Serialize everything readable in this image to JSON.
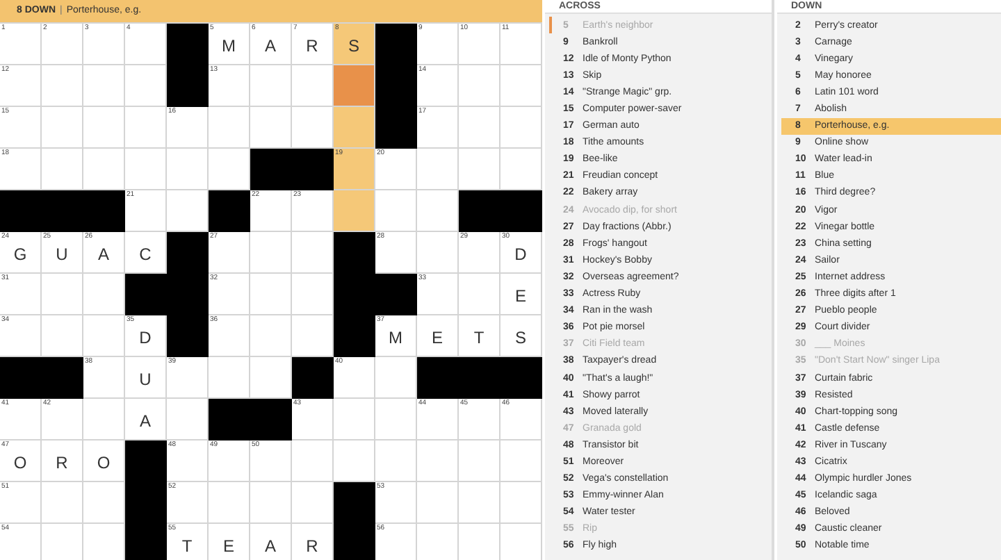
{
  "clue_bar": {
    "label": "8 DOWN",
    "separator": "|",
    "text": "Porterhouse, e.g."
  },
  "grid": {
    "rows": [
      [
        {
          "kind": "open",
          "number": "1"
        },
        {
          "kind": "open",
          "number": "2"
        },
        {
          "kind": "open",
          "number": "3"
        },
        {
          "kind": "open",
          "number": "4"
        },
        {
          "kind": "block"
        },
        {
          "kind": "open",
          "number": "5",
          "letter": "M"
        },
        {
          "kind": "open",
          "number": "6",
          "letter": "A"
        },
        {
          "kind": "open",
          "number": "7",
          "letter": "R"
        },
        {
          "kind": "word",
          "number": "8",
          "letter": "S"
        },
        {
          "kind": "block"
        },
        {
          "kind": "open",
          "number": "9"
        },
        {
          "kind": "open",
          "number": "10"
        },
        {
          "kind": "open",
          "number": "11"
        }
      ],
      [
        {
          "kind": "open",
          "number": "12"
        },
        {
          "kind": "open"
        },
        {
          "kind": "open"
        },
        {
          "kind": "open"
        },
        {
          "kind": "block"
        },
        {
          "kind": "open",
          "number": "13"
        },
        {
          "kind": "open"
        },
        {
          "kind": "open"
        },
        {
          "kind": "cursor"
        },
        {
          "kind": "block"
        },
        {
          "kind": "open",
          "number": "14"
        },
        {
          "kind": "open"
        },
        {
          "kind": "open"
        }
      ],
      [
        {
          "kind": "open",
          "number": "15"
        },
        {
          "kind": "open"
        },
        {
          "kind": "open"
        },
        {
          "kind": "open"
        },
        {
          "kind": "open",
          "number": "16"
        },
        {
          "kind": "open"
        },
        {
          "kind": "open"
        },
        {
          "kind": "open"
        },
        {
          "kind": "word"
        },
        {
          "kind": "block"
        },
        {
          "kind": "open",
          "number": "17"
        },
        {
          "kind": "open"
        },
        {
          "kind": "open"
        }
      ],
      [
        {
          "kind": "open",
          "number": "18"
        },
        {
          "kind": "open"
        },
        {
          "kind": "open"
        },
        {
          "kind": "open"
        },
        {
          "kind": "open"
        },
        {
          "kind": "open"
        },
        {
          "kind": "block"
        },
        {
          "kind": "block"
        },
        {
          "kind": "word",
          "number": "19"
        },
        {
          "kind": "open",
          "number": "20"
        },
        {
          "kind": "open"
        },
        {
          "kind": "open"
        },
        {
          "kind": "open"
        }
      ],
      [
        {
          "kind": "block"
        },
        {
          "kind": "block"
        },
        {
          "kind": "block"
        },
        {
          "kind": "open",
          "number": "21"
        },
        {
          "kind": "open"
        },
        {
          "kind": "block"
        },
        {
          "kind": "open",
          "number": "22"
        },
        {
          "kind": "open",
          "number": "23"
        },
        {
          "kind": "word"
        },
        {
          "kind": "open"
        },
        {
          "kind": "open"
        },
        {
          "kind": "block"
        },
        {
          "kind": "block"
        }
      ],
      [
        {
          "kind": "open",
          "number": "24",
          "letter": "G"
        },
        {
          "kind": "open",
          "number": "25",
          "letter": "U"
        },
        {
          "kind": "open",
          "number": "26",
          "letter": "A"
        },
        {
          "kind": "open",
          "letter": "C"
        },
        {
          "kind": "block"
        },
        {
          "kind": "open",
          "number": "27"
        },
        {
          "kind": "open"
        },
        {
          "kind": "open"
        },
        {
          "kind": "block"
        },
        {
          "kind": "open",
          "number": "28"
        },
        {
          "kind": "open"
        },
        {
          "kind": "open",
          "number": "29"
        },
        {
          "kind": "open",
          "number": "30",
          "letter": "D"
        }
      ],
      [
        {
          "kind": "open",
          "number": "31"
        },
        {
          "kind": "open"
        },
        {
          "kind": "open"
        },
        {
          "kind": "block"
        },
        {
          "kind": "block"
        },
        {
          "kind": "open",
          "number": "32"
        },
        {
          "kind": "open"
        },
        {
          "kind": "open"
        },
        {
          "kind": "block"
        },
        {
          "kind": "block"
        },
        {
          "kind": "open",
          "number": "33"
        },
        {
          "kind": "open"
        },
        {
          "kind": "open",
          "letter": "E"
        }
      ],
      [
        {
          "kind": "open",
          "number": "34"
        },
        {
          "kind": "open"
        },
        {
          "kind": "open"
        },
        {
          "kind": "open",
          "number": "35",
          "letter": "D"
        },
        {
          "kind": "block"
        },
        {
          "kind": "open",
          "number": "36"
        },
        {
          "kind": "open"
        },
        {
          "kind": "open"
        },
        {
          "kind": "block"
        },
        {
          "kind": "open",
          "number": "37",
          "letter": "M"
        },
        {
          "kind": "open",
          "letter": "E"
        },
        {
          "kind": "open",
          "letter": "T"
        },
        {
          "kind": "open",
          "letter": "S"
        }
      ],
      [
        {
          "kind": "block"
        },
        {
          "kind": "block"
        },
        {
          "kind": "open",
          "number": "38"
        },
        {
          "kind": "open",
          "letter": "U"
        },
        {
          "kind": "open",
          "number": "39"
        },
        {
          "kind": "open"
        },
        {
          "kind": "open"
        },
        {
          "kind": "block"
        },
        {
          "kind": "open",
          "number": "40"
        },
        {
          "kind": "open"
        },
        {
          "kind": "block"
        },
        {
          "kind": "block"
        },
        {
          "kind": "block"
        }
      ],
      [
        {
          "kind": "open",
          "number": "41"
        },
        {
          "kind": "open",
          "number": "42"
        },
        {
          "kind": "open"
        },
        {
          "kind": "open",
          "letter": "A"
        },
        {
          "kind": "open"
        },
        {
          "kind": "block"
        },
        {
          "kind": "block"
        },
        {
          "kind": "open",
          "number": "43"
        },
        {
          "kind": "open"
        },
        {
          "kind": "open"
        },
        {
          "kind": "open",
          "number": "44"
        },
        {
          "kind": "open",
          "number": "45"
        },
        {
          "kind": "open",
          "number": "46"
        }
      ],
      [
        {
          "kind": "open",
          "number": "47",
          "letter": "O"
        },
        {
          "kind": "open",
          "letter": "R"
        },
        {
          "kind": "open",
          "letter": "O"
        },
        {
          "kind": "block"
        },
        {
          "kind": "open",
          "number": "48"
        },
        {
          "kind": "open",
          "number": "49"
        },
        {
          "kind": "open",
          "number": "50"
        },
        {
          "kind": "open"
        },
        {
          "kind": "open"
        },
        {
          "kind": "open"
        },
        {
          "kind": "open"
        },
        {
          "kind": "open"
        },
        {
          "kind": "open"
        }
      ],
      [
        {
          "kind": "open",
          "number": "51"
        },
        {
          "kind": "open"
        },
        {
          "kind": "open"
        },
        {
          "kind": "block"
        },
        {
          "kind": "open",
          "number": "52"
        },
        {
          "kind": "open"
        },
        {
          "kind": "open"
        },
        {
          "kind": "open"
        },
        {
          "kind": "block"
        },
        {
          "kind": "open",
          "number": "53"
        },
        {
          "kind": "open"
        },
        {
          "kind": "open"
        },
        {
          "kind": "open"
        }
      ],
      [
        {
          "kind": "open",
          "number": "54"
        },
        {
          "kind": "open"
        },
        {
          "kind": "open"
        },
        {
          "kind": "block"
        },
        {
          "kind": "open",
          "number": "55",
          "letter": "T"
        },
        {
          "kind": "open",
          "letter": "E"
        },
        {
          "kind": "open",
          "letter": "A"
        },
        {
          "kind": "open",
          "letter": "R"
        },
        {
          "kind": "block"
        },
        {
          "kind": "open",
          "number": "56"
        },
        {
          "kind": "open"
        },
        {
          "kind": "open"
        },
        {
          "kind": "open"
        }
      ]
    ]
  },
  "clue_lists": [
    {
      "title": "ACROSS",
      "clues": [
        {
          "number": "5",
          "text": "Earth's neighbor",
          "completed": true,
          "crossing": true,
          "selected": false
        },
        {
          "number": "9",
          "text": "Bankroll",
          "completed": false,
          "crossing": false,
          "selected": false
        },
        {
          "number": "12",
          "text": "Idle of Monty Python",
          "completed": false,
          "crossing": false,
          "selected": false
        },
        {
          "number": "13",
          "text": "Skip",
          "completed": false,
          "crossing": false,
          "selected": false
        },
        {
          "number": "14",
          "text": "\"Strange Magic\" grp.",
          "completed": false,
          "crossing": false,
          "selected": false
        },
        {
          "number": "15",
          "text": "Computer power-saver",
          "completed": false,
          "crossing": false,
          "selected": false
        },
        {
          "number": "17",
          "text": "German auto",
          "completed": false,
          "crossing": false,
          "selected": false
        },
        {
          "number": "18",
          "text": "Tithe amounts",
          "completed": false,
          "crossing": false,
          "selected": false
        },
        {
          "number": "19",
          "text": "Bee-like",
          "completed": false,
          "crossing": false,
          "selected": false
        },
        {
          "number": "21",
          "text": "Freudian concept",
          "completed": false,
          "crossing": false,
          "selected": false
        },
        {
          "number": "22",
          "text": "Bakery array",
          "completed": false,
          "crossing": false,
          "selected": false
        },
        {
          "number": "24",
          "text": "Avocado dip, for short",
          "completed": true,
          "crossing": false,
          "selected": false
        },
        {
          "number": "27",
          "text": "Day fractions (Abbr.)",
          "completed": false,
          "crossing": false,
          "selected": false
        },
        {
          "number": "28",
          "text": "Frogs' hangout",
          "completed": false,
          "crossing": false,
          "selected": false
        },
        {
          "number": "31",
          "text": "Hockey's Bobby",
          "completed": false,
          "crossing": false,
          "selected": false
        },
        {
          "number": "32",
          "text": "Overseas agreement?",
          "completed": false,
          "crossing": false,
          "selected": false
        },
        {
          "number": "33",
          "text": "Actress Ruby",
          "completed": false,
          "crossing": false,
          "selected": false
        },
        {
          "number": "34",
          "text": "Ran in the wash",
          "completed": false,
          "crossing": false,
          "selected": false
        },
        {
          "number": "36",
          "text": "Pot pie morsel",
          "completed": false,
          "crossing": false,
          "selected": false
        },
        {
          "number": "37",
          "text": "Citi Field team",
          "completed": true,
          "crossing": false,
          "selected": false
        },
        {
          "number": "38",
          "text": "Taxpayer's dread",
          "completed": false,
          "crossing": false,
          "selected": false
        },
        {
          "number": "40",
          "text": "\"That's a laugh!\"",
          "completed": false,
          "crossing": false,
          "selected": false
        },
        {
          "number": "41",
          "text": "Showy parrot",
          "completed": false,
          "crossing": false,
          "selected": false
        },
        {
          "number": "43",
          "text": "Moved laterally",
          "completed": false,
          "crossing": false,
          "selected": false
        },
        {
          "number": "47",
          "text": "Granada gold",
          "completed": true,
          "crossing": false,
          "selected": false
        },
        {
          "number": "48",
          "text": "Transistor bit",
          "completed": false,
          "crossing": false,
          "selected": false
        },
        {
          "number": "51",
          "text": "Moreover",
          "completed": false,
          "crossing": false,
          "selected": false
        },
        {
          "number": "52",
          "text": "Vega's constellation",
          "completed": false,
          "crossing": false,
          "selected": false
        },
        {
          "number": "53",
          "text": "Emmy-winner Alan",
          "completed": false,
          "crossing": false,
          "selected": false
        },
        {
          "number": "54",
          "text": "Water tester",
          "completed": false,
          "crossing": false,
          "selected": false
        },
        {
          "number": "55",
          "text": "Rip",
          "completed": true,
          "crossing": false,
          "selected": false
        },
        {
          "number": "56",
          "text": "Fly high",
          "completed": false,
          "crossing": false,
          "selected": false
        }
      ]
    },
    {
      "title": "DOWN",
      "clues": [
        {
          "number": "2",
          "text": "Perry's creator",
          "completed": false,
          "crossing": false,
          "selected": false
        },
        {
          "number": "3",
          "text": "Carnage",
          "completed": false,
          "crossing": false,
          "selected": false
        },
        {
          "number": "4",
          "text": "Vinegary",
          "completed": false,
          "crossing": false,
          "selected": false
        },
        {
          "number": "5",
          "text": "May honoree",
          "completed": false,
          "crossing": false,
          "selected": false
        },
        {
          "number": "6",
          "text": "Latin 101 word",
          "completed": false,
          "crossing": false,
          "selected": false
        },
        {
          "number": "7",
          "text": "Abolish",
          "completed": false,
          "crossing": false,
          "selected": false
        },
        {
          "number": "8",
          "text": "Porterhouse, e.g.",
          "completed": false,
          "crossing": false,
          "selected": true
        },
        {
          "number": "9",
          "text": "Online show",
          "completed": false,
          "crossing": false,
          "selected": false
        },
        {
          "number": "10",
          "text": "Water lead-in",
          "completed": false,
          "crossing": false,
          "selected": false
        },
        {
          "number": "11",
          "text": "Blue",
          "completed": false,
          "crossing": false,
          "selected": false
        },
        {
          "number": "16",
          "text": "Third degree?",
          "completed": false,
          "crossing": false,
          "selected": false
        },
        {
          "number": "20",
          "text": "Vigor",
          "completed": false,
          "crossing": false,
          "selected": false
        },
        {
          "number": "22",
          "text": "Vinegar bottle",
          "completed": false,
          "crossing": false,
          "selected": false
        },
        {
          "number": "23",
          "text": "China setting",
          "completed": false,
          "crossing": false,
          "selected": false
        },
        {
          "number": "24",
          "text": "Sailor",
          "completed": false,
          "crossing": false,
          "selected": false
        },
        {
          "number": "25",
          "text": "Internet address",
          "completed": false,
          "crossing": false,
          "selected": false
        },
        {
          "number": "26",
          "text": "Three digits after 1",
          "completed": false,
          "crossing": false,
          "selected": false
        },
        {
          "number": "27",
          "text": "Pueblo people",
          "completed": false,
          "crossing": false,
          "selected": false
        },
        {
          "number": "29",
          "text": "Court divider",
          "completed": false,
          "crossing": false,
          "selected": false
        },
        {
          "number": "30",
          "text": "___ Moines",
          "completed": true,
          "crossing": false,
          "selected": false
        },
        {
          "number": "35",
          "text": "\"Don't Start Now\" singer Lipa",
          "completed": true,
          "crossing": false,
          "selected": false
        },
        {
          "number": "37",
          "text": "Curtain fabric",
          "completed": false,
          "crossing": false,
          "selected": false
        },
        {
          "number": "39",
          "text": "Resisted",
          "completed": false,
          "crossing": false,
          "selected": false
        },
        {
          "number": "40",
          "text": "Chart-topping song",
          "completed": false,
          "crossing": false,
          "selected": false
        },
        {
          "number": "41",
          "text": "Castle defense",
          "completed": false,
          "crossing": false,
          "selected": false
        },
        {
          "number": "42",
          "text": "River in Tuscany",
          "completed": false,
          "crossing": false,
          "selected": false
        },
        {
          "number": "43",
          "text": "Cicatrix",
          "completed": false,
          "crossing": false,
          "selected": false
        },
        {
          "number": "44",
          "text": "Olympic hurdler Jones",
          "completed": false,
          "crossing": false,
          "selected": false
        },
        {
          "number": "45",
          "text": "Icelandic saga",
          "completed": false,
          "crossing": false,
          "selected": false
        },
        {
          "number": "46",
          "text": "Beloved",
          "completed": false,
          "crossing": false,
          "selected": false
        },
        {
          "number": "49",
          "text": "Caustic cleaner",
          "completed": false,
          "crossing": false,
          "selected": false
        },
        {
          "number": "50",
          "text": "Notable time",
          "completed": false,
          "crossing": false,
          "selected": false
        }
      ]
    }
  ]
}
